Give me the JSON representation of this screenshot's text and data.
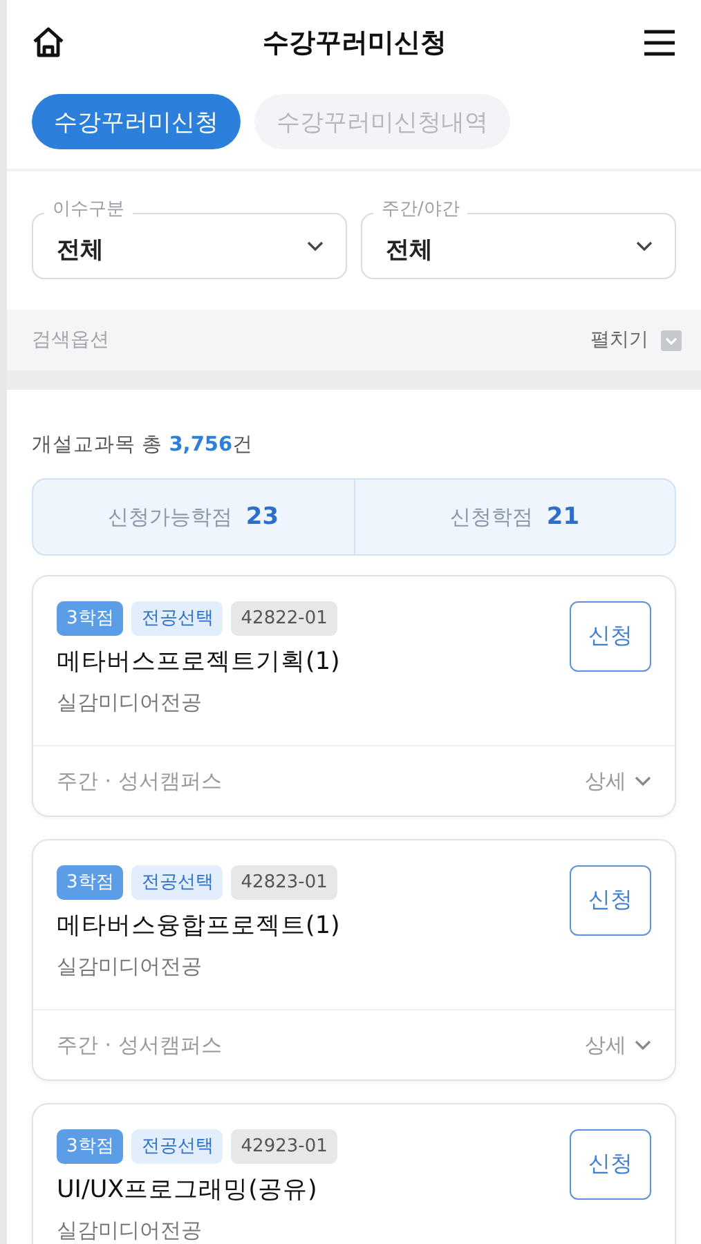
{
  "header": {
    "title": "수강꾸러미신청"
  },
  "tabs": [
    {
      "label": "수강꾸러미신청",
      "selected": true
    },
    {
      "label": "수강꾸러미신청내역",
      "selected": false
    }
  ],
  "filters": [
    {
      "label": "이수구분",
      "value": "전체"
    },
    {
      "label": "주간/야간",
      "value": "전체"
    }
  ],
  "search_options": {
    "label": "검색옵션",
    "toggle": "펼치기"
  },
  "summary": "개설교과목 총 **3,756**건",
  "credits": [
    {
      "label": "신청가능학점",
      "value": "23"
    },
    {
      "label": "신청학점",
      "value": "21"
    }
  ],
  "courses": [
    {
      "credits": "3학점",
      "category": "전공선택",
      "code": "42822-01",
      "name": "메타버스프로젝트기획(1)",
      "major": "실감미디어전공",
      "info": "주간 · 성서캠퍼스",
      "detail": "상세",
      "button": "신청"
    },
    {
      "credits": "3학점",
      "category": "전공선택",
      "code": "42823-01",
      "name": "메타버스융합프로젝트(1)",
      "major": "실감미디어전공",
      "info": "주간 · 성서캠퍼스",
      "detail": "상세",
      "button": "신청"
    },
    {
      "credits": "3학점",
      "category": "전공선택",
      "code": "42923-01",
      "name": "UI/UX프로그래밍(공유)",
      "major": "실감미디어전공",
      "button": "신청"
    }
  ]
}
